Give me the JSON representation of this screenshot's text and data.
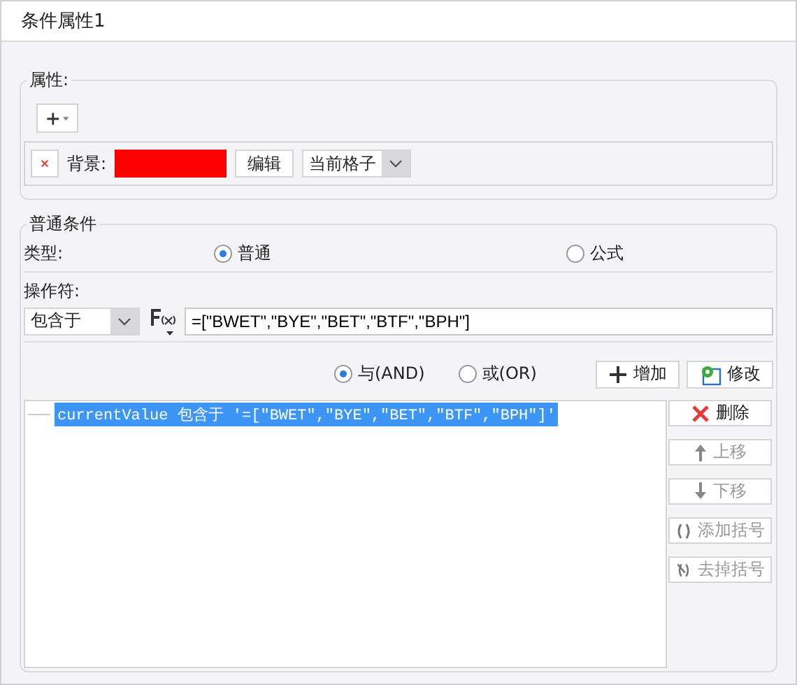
{
  "window": {
    "title": "条件属性1"
  },
  "properties": {
    "legend": "属性:",
    "items": [
      {
        "kind": "background",
        "label": "背景:",
        "color": "#ff0000",
        "edit_button": "编辑",
        "scope": "当前格子"
      }
    ]
  },
  "condition": {
    "legend": "普通条件",
    "type_label": "类型:",
    "types": [
      {
        "label": "普通",
        "selected": true
      },
      {
        "label": "公式",
        "selected": false
      }
    ],
    "operator_label": "操作符:",
    "operator": "包含于",
    "value": "=[\"BWET\",\"BYE\",\"BET\",\"BTF\",\"BPH\"]",
    "joins": [
      {
        "label": "与(AND)",
        "selected": true
      },
      {
        "label": "或(OR)",
        "selected": false
      }
    ],
    "add_button": "增加",
    "modify_button": "修改",
    "conditions": [
      {
        "text": "currentValue 包含于 '=[\"BWET\",\"BYE\",\"BET\",\"BTF\",\"BPH\"]'",
        "selected": true
      }
    ],
    "actions": [
      {
        "kind": "delete",
        "label": "删除",
        "disabled": false
      },
      {
        "kind": "up",
        "label": "上移",
        "disabled": true
      },
      {
        "kind": "down",
        "label": "下移",
        "disabled": true
      },
      {
        "kind": "add-bracket",
        "label": "添加括号",
        "disabled": true
      },
      {
        "kind": "remove-bracket",
        "label": "去掉括号",
        "disabled": true
      }
    ]
  }
}
